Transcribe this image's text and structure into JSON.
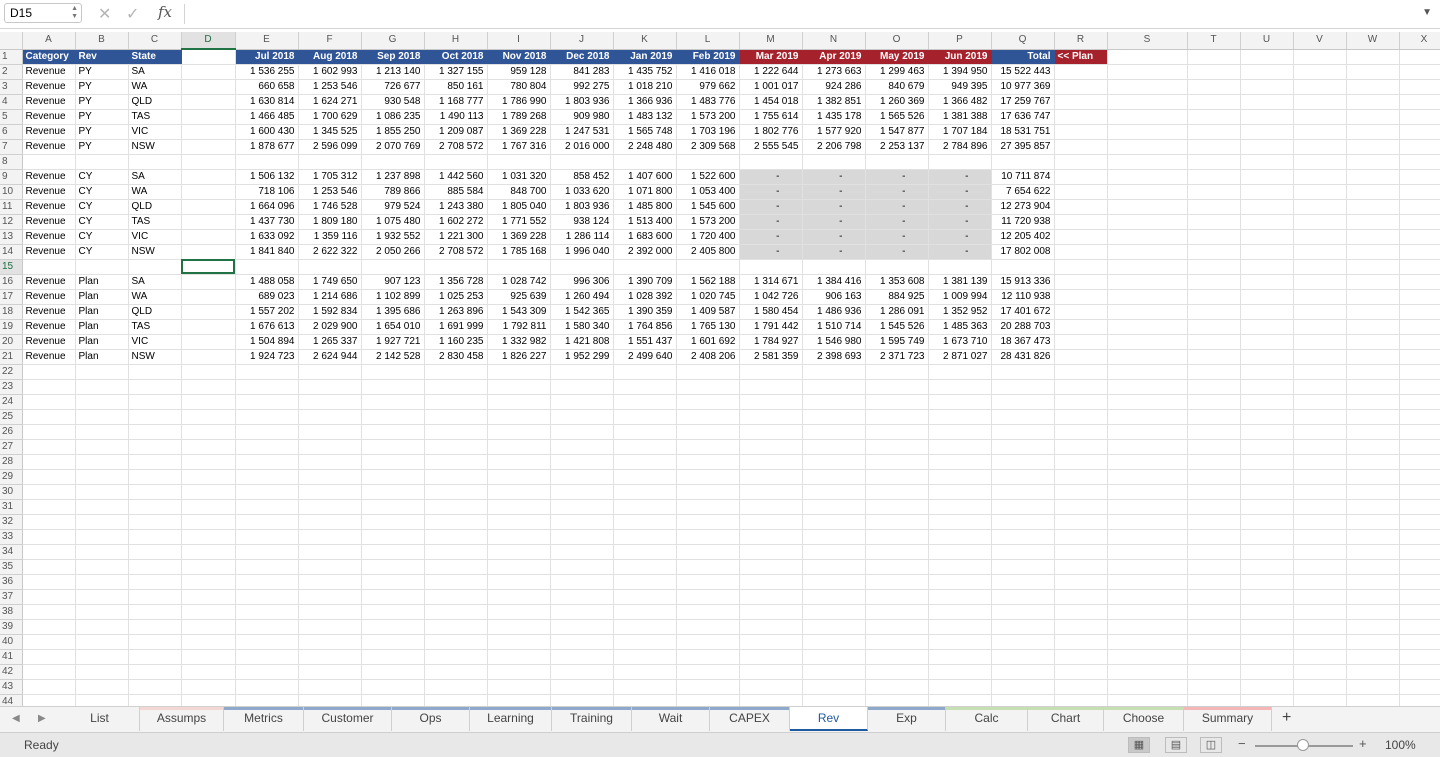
{
  "formula_bar": {
    "name_box": "D15",
    "fx_label": "fx",
    "formula": ""
  },
  "columns": [
    "A",
    "B",
    "C",
    "D",
    "E",
    "F",
    "G",
    "H",
    "I",
    "J",
    "K",
    "L",
    "M",
    "N",
    "O",
    "P",
    "Q",
    "R",
    "S",
    "T",
    "U",
    "V",
    "W",
    "X"
  ],
  "selected_column": "D",
  "selected_row": 15,
  "header_row": {
    "category": "Category",
    "rev": "Rev",
    "state": "State",
    "months": [
      "Jul 2018",
      "Aug 2018",
      "Sep 2018",
      "Oct 2018",
      "Nov 2018",
      "Dec 2018",
      "Jan 2019",
      "Feb 2019",
      "Mar 2019",
      "Apr 2019",
      "May 2019",
      "Jun 2019"
    ],
    "total": "Total",
    "plan_note": "<< Plan"
  },
  "rows": [
    {
      "row": 2,
      "category": "Revenue",
      "rev": "PY",
      "state": "SA",
      "values": [
        "1 536 255",
        "1 602 993",
        "1 213 140",
        "1 327 155",
        "959 128",
        "841 283",
        "1 435 752",
        "1 416 018",
        "1 222 644",
        "1 273 663",
        "1 299 463",
        "1 394 950"
      ],
      "total": "15 522 443"
    },
    {
      "row": 3,
      "category": "Revenue",
      "rev": "PY",
      "state": "WA",
      "values": [
        "660 658",
        "1 253 546",
        "726 677",
        "850 161",
        "780 804",
        "992 275",
        "1 018 210",
        "979 662",
        "1 001 017",
        "924 286",
        "840 679",
        "949 395"
      ],
      "total": "10 977 369"
    },
    {
      "row": 4,
      "category": "Revenue",
      "rev": "PY",
      "state": "QLD",
      "values": [
        "1 630 814",
        "1 624 271",
        "930 548",
        "1 168 777",
        "1 786 990",
        "1 803 936",
        "1 366 936",
        "1 483 776",
        "1 454 018",
        "1 382 851",
        "1 260 369",
        "1 366 482"
      ],
      "total": "17 259 767"
    },
    {
      "row": 5,
      "category": "Revenue",
      "rev": "PY",
      "state": "TAS",
      "values": [
        "1 466 485",
        "1 700 629",
        "1 086 235",
        "1 490 113",
        "1 789 268",
        "909 980",
        "1 483 132",
        "1 573 200",
        "1 755 614",
        "1 435 178",
        "1 565 526",
        "1 381 388"
      ],
      "total": "17 636 747"
    },
    {
      "row": 6,
      "category": "Revenue",
      "rev": "PY",
      "state": "VIC",
      "values": [
        "1 600 430",
        "1 345 525",
        "1 855 250",
        "1 209 087",
        "1 369 228",
        "1 247 531",
        "1 565 748",
        "1 703 196",
        "1 802 776",
        "1 577 920",
        "1 547 877",
        "1 707 184"
      ],
      "total": "18 531 751"
    },
    {
      "row": 7,
      "category": "Revenue",
      "rev": "PY",
      "state": "NSW",
      "values": [
        "1 878 677",
        "2 596 099",
        "2 070 769",
        "2 708 572",
        "1 767 316",
        "2 016 000",
        "2 248 480",
        "2 309 568",
        "2 555 545",
        "2 206 798",
        "2 253 137",
        "2 784 896"
      ],
      "total": "27 395 857"
    },
    {
      "row": 8,
      "empty": true
    },
    {
      "row": 9,
      "category": "Revenue",
      "rev": "CY",
      "state": "SA",
      "values": [
        "1 506 132",
        "1 705 312",
        "1 237 898",
        "1 442 560",
        "1 031 320",
        "858 452",
        "1 407 600",
        "1 522 600",
        "-",
        "-",
        "-",
        "-"
      ],
      "total": "10 711 874"
    },
    {
      "row": 10,
      "category": "Revenue",
      "rev": "CY",
      "state": "WA",
      "values": [
        "718 106",
        "1 253 546",
        "789 866",
        "885 584",
        "848 700",
        "1 033 620",
        "1 071 800",
        "1 053 400",
        "-",
        "-",
        "-",
        "-"
      ],
      "total": "7 654 622"
    },
    {
      "row": 11,
      "category": "Revenue",
      "rev": "CY",
      "state": "QLD",
      "values": [
        "1 664 096",
        "1 746 528",
        "979 524",
        "1 243 380",
        "1 805 040",
        "1 803 936",
        "1 485 800",
        "1 545 600",
        "-",
        "-",
        "-",
        "-"
      ],
      "total": "12 273 904"
    },
    {
      "row": 12,
      "category": "Revenue",
      "rev": "CY",
      "state": "TAS",
      "values": [
        "1 437 730",
        "1 809 180",
        "1 075 480",
        "1 602 272",
        "1 771 552",
        "938 124",
        "1 513 400",
        "1 573 200",
        "-",
        "-",
        "-",
        "-"
      ],
      "total": "11 720 938"
    },
    {
      "row": 13,
      "category": "Revenue",
      "rev": "CY",
      "state": "VIC",
      "values": [
        "1 633 092",
        "1 359 116",
        "1 932 552",
        "1 221 300",
        "1 369 228",
        "1 286 114",
        "1 683 600",
        "1 720 400",
        "-",
        "-",
        "-",
        "-"
      ],
      "total": "12 205 402"
    },
    {
      "row": 14,
      "category": "Revenue",
      "rev": "CY",
      "state": "NSW",
      "values": [
        "1 841 840",
        "2 622 322",
        "2 050 266",
        "2 708 572",
        "1 785 168",
        "1 996 040",
        "2 392 000",
        "2 405 800",
        "-",
        "-",
        "-",
        "-"
      ],
      "total": "17 802 008"
    },
    {
      "row": 15,
      "empty": true
    },
    {
      "row": 16,
      "category": "Revenue",
      "rev": "Plan",
      "state": "SA",
      "values": [
        "1 488 058",
        "1 749 650",
        "907 123",
        "1 356 728",
        "1 028 742",
        "996 306",
        "1 390 709",
        "1 562 188",
        "1 314 671",
        "1 384 416",
        "1 353 608",
        "1 381 139"
      ],
      "total": "15 913 336"
    },
    {
      "row": 17,
      "category": "Revenue",
      "rev": "Plan",
      "state": "WA",
      "values": [
        "689 023",
        "1 214 686",
        "1 102 899",
        "1 025 253",
        "925 639",
        "1 260 494",
        "1 028 392",
        "1 020 745",
        "1 042 726",
        "906 163",
        "884 925",
        "1 009 994"
      ],
      "total": "12 110 938"
    },
    {
      "row": 18,
      "category": "Revenue",
      "rev": "Plan",
      "state": "QLD",
      "values": [
        "1 557 202",
        "1 592 834",
        "1 395 686",
        "1 263 896",
        "1 543 309",
        "1 542 365",
        "1 390 359",
        "1 409 587",
        "1 580 454",
        "1 486 936",
        "1 286 091",
        "1 352 952"
      ],
      "total": "17 401 672"
    },
    {
      "row": 19,
      "category": "Revenue",
      "rev": "Plan",
      "state": "TAS",
      "values": [
        "1 676 613",
        "2 029 900",
        "1 654 010",
        "1 691 999",
        "1 792 811",
        "1 580 340",
        "1 764 856",
        "1 765 130",
        "1 791 442",
        "1 510 714",
        "1 545 526",
        "1 485 363"
      ],
      "total": "20 288 703"
    },
    {
      "row": 20,
      "category": "Revenue",
      "rev": "Plan",
      "state": "VIC",
      "values": [
        "1 504 894",
        "1 265 337",
        "1 927 721",
        "1 160 235",
        "1 332 982",
        "1 421 808",
        "1 551 437",
        "1 601 692",
        "1 784 927",
        "1 546 980",
        "1 595 749",
        "1 673 710"
      ],
      "total": "18 367 473"
    },
    {
      "row": 21,
      "category": "Revenue",
      "rev": "Plan",
      "state": "NSW",
      "values": [
        "1 924 723",
        "2 624 944",
        "2 142 528",
        "2 830 458",
        "1 826 227",
        "1 952 299",
        "2 499 640",
        "2 408 206",
        "2 581 359",
        "2 398 693",
        "2 371 723",
        "2 871 027"
      ],
      "total": "28 431 826"
    }
  ],
  "empty_rows_through": 44,
  "sheet_tabs": [
    {
      "label": "List",
      "color": ""
    },
    {
      "label": "Assumps",
      "color": "#f2d7d5"
    },
    {
      "label": "Metrics",
      "color": "#8ea9c9"
    },
    {
      "label": "Customer",
      "color": "#8ea9c9"
    },
    {
      "label": "Ops",
      "color": "#8ea9c9"
    },
    {
      "label": "Learning",
      "color": "#8ea9c9"
    },
    {
      "label": "Training",
      "color": "#8ea9c9"
    },
    {
      "label": "Wait",
      "color": "#8ea9c9"
    },
    {
      "label": "CAPEX",
      "color": "#8ea9c9"
    },
    {
      "label": "Rev",
      "color": "",
      "active": true
    },
    {
      "label": "Exp",
      "color": "#8ea9c9"
    },
    {
      "label": "Calc",
      "color": "#c6e0b4"
    },
    {
      "label": "Chart",
      "color": "#c6e0b4"
    },
    {
      "label": "Choose",
      "color": "#c6e0b4"
    },
    {
      "label": "Summary",
      "color": "#f4b6b6"
    }
  ],
  "status": {
    "mode": "Ready",
    "zoom": "100%"
  },
  "colors": {
    "header_blue": "#2f5597",
    "plan_red": "#a5222d",
    "excel_green": "#217346",
    "forecast_gray": "#d8d8d8"
  }
}
